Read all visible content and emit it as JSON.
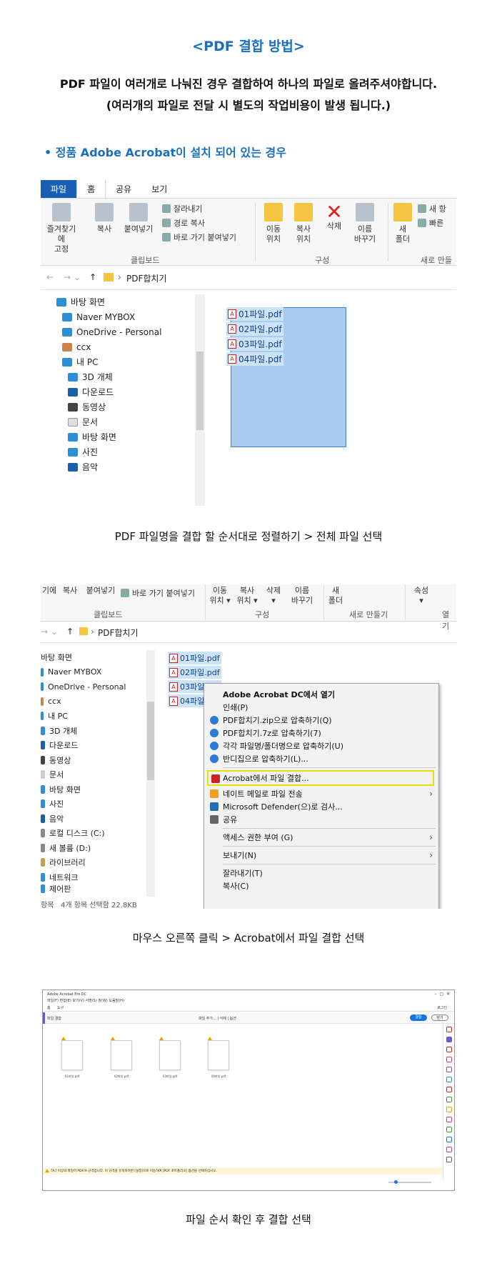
{
  "header": {
    "title": "<PDF 결합 방법>",
    "desc1": "PDF 파일이 여러개로 나눠진 경우 결합하여 하나의 파일로 올려주셔야합니다.",
    "desc2": "(여러개의 파일로 전달 시 별도의 작업비용이 발생 됩니다.)",
    "bullet": "• 정품 Adobe Acrobat이 설치 되어 있는 경우"
  },
  "shot1": {
    "tabs": [
      "파일",
      "홈",
      "공유",
      "보기"
    ],
    "ribbon": {
      "pin": "즐겨찾기에\n고정",
      "copy": "복사",
      "paste": "붙여넣기",
      "cut": "잘라내기",
      "copy_path": "경로 복사",
      "paste_shortcut": "바로 가기 붙여넣기",
      "clipboard": "클립보드",
      "move": "이동\n위치",
      "copyto": "복사\n위치",
      "delete": "삭제",
      "rename": "이름\n바꾸기",
      "organize": "구성",
      "newfolder": "새\n폴더",
      "new_item": "새 항",
      "quick": "빠른",
      "new_group": "새로 만들"
    },
    "path": "PDF합치기",
    "nav": [
      "바탕 화면",
      "Naver MYBOX",
      "OneDrive - Personal",
      "ccx",
      "내 PC",
      "3D 개체",
      "다운로드",
      "동영상",
      "문서",
      "바탕 화면",
      "사진",
      "음악"
    ],
    "files": [
      "01파일.pdf",
      "02파일.pdf",
      "03파일.pdf",
      "04파일.pdf"
    ]
  },
  "caption1": "PDF 파일명을 결합 할 순서대로 정렬하기 > 전체 파일 선택",
  "shot2": {
    "ribbon": {
      "partial1": "기에",
      "copy": "복사",
      "paste": "붙여넣기",
      "paste_shortcut": "바로 가기 붙여넣기",
      "clipboard": "클립보드",
      "move": "이동\n위치 ▾",
      "copyto": "복사\n위치 ▾",
      "delete": "삭제\n▾",
      "rename": "이름\n바꾸기",
      "organize": "구성",
      "newfolder": "새\n폴더",
      "new_group": "새로 만들기",
      "props": "속성\n▾",
      "open_group": "열기"
    },
    "path": "PDF합치기",
    "nav": [
      "바탕 화면",
      "Naver MYBOX",
      "OneDrive - Personal",
      "ccx",
      "내 PC",
      "3D 개체",
      "다운로드",
      "동영상",
      "문서",
      "바탕 화면",
      "사진",
      "음악",
      "로컬 디스크 (C:)",
      "새 볼륨 (D:)",
      "라이브러리",
      "네트워크",
      "제어판"
    ],
    "files": [
      "01파일.pdf",
      "02파일.pdf",
      "03파일.pdf",
      "04파일"
    ],
    "status": "4개 항목 선택함 22.8KB",
    "status_left": "항목",
    "menu": {
      "open": "Adobe Acrobat DC에서 열기",
      "print": "인쇄(P)",
      "zip": "PDF합치기.zip으로 압축하기(Q)",
      "sevenz": "PDF합치기.7z로 압축하기(7)",
      "each": "각각 파일명/폴더명으로 압축하기(U)",
      "bandizip": "반디집으로 압축하기(L)...",
      "combine": "Acrobat에서 파일 결합...",
      "naver": "네이트 메일로 파일 전송",
      "defender": "Microsoft Defender(으)로 검사...",
      "share": "공유",
      "access": "액세스 권한 부여 (G)",
      "sendto": "보내기(N)",
      "cut": "잘라내기(T)",
      "copy": "복사(C)"
    }
  },
  "caption2": "마우스 오른쪽 클릭 > Acrobat에서 파일 결합 선택",
  "shot3": {
    "window_title": "Adobe Acrobat Pro DC",
    "menu": "파일(F)  편집(E)  보기(V)  서명(S)  창(W)  도움말(H)",
    "tabs": [
      "홈",
      "도구"
    ],
    "panel_title": "파일 결합",
    "toolbar": "파일 추가...  |  삭제  |  옵션",
    "combine_btn": "결합",
    "close_btn": "닫기",
    "login": "로그인",
    "docs": [
      "01파일.pdf",
      "02파일.pdf",
      "03파일.pdf",
      "04파일.pdf"
    ],
    "notice": "하나 이상의 파일이 PDF/A 규격입니다. 이 규격을 유지하려면 [설정]으로 이동하여 [PDF 포트폴리오] 옵션을 선택하십시오."
  },
  "caption3": "파일 순서 확인 후 결합 선택"
}
